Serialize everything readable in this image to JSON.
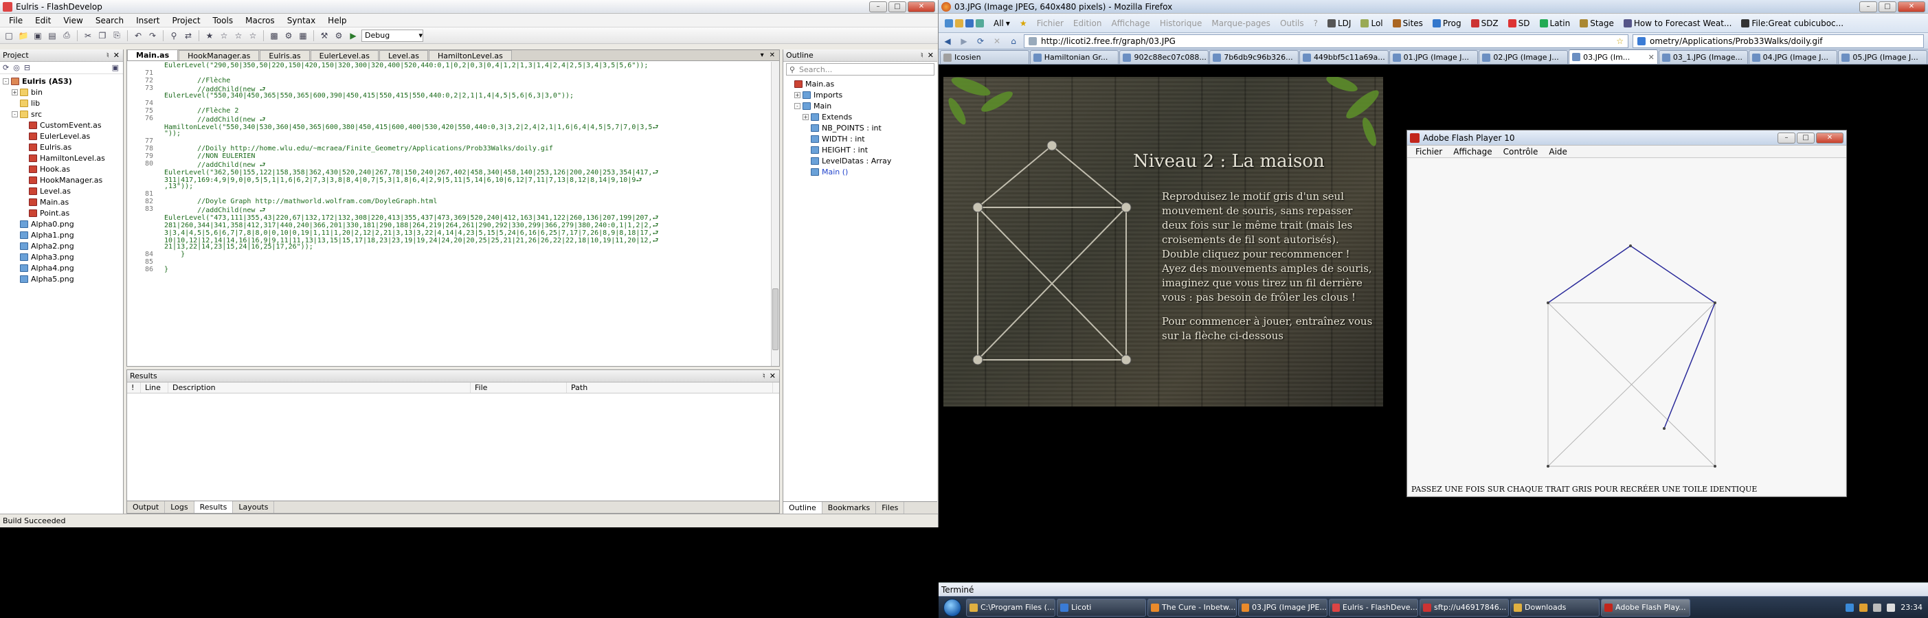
{
  "fd": {
    "title": "Eulris - FlashDevelop",
    "menu": [
      "File",
      "Edit",
      "View",
      "Search",
      "Insert",
      "Project",
      "Tools",
      "Macros",
      "Syntax",
      "Help"
    ],
    "build_config": "Debug",
    "project_panel_title": "Project",
    "tree": [
      {
        "label": "Eulris (AS3)",
        "indent": 0,
        "type": "proj",
        "exp": "-",
        "bold": true
      },
      {
        "label": "bin",
        "indent": 1,
        "type": "folder",
        "exp": "+"
      },
      {
        "label": "lib",
        "indent": 1,
        "type": "folder",
        "exp": ""
      },
      {
        "label": "src",
        "indent": 1,
        "type": "folder",
        "exp": "-"
      },
      {
        "label": "CustomEvent.as",
        "indent": 2,
        "type": "as",
        "exp": ""
      },
      {
        "label": "EulerLevel.as",
        "indent": 2,
        "type": "as",
        "exp": ""
      },
      {
        "label": "Eulris.as",
        "indent": 2,
        "type": "as",
        "exp": ""
      },
      {
        "label": "HamiltonLevel.as",
        "indent": 2,
        "type": "as",
        "exp": ""
      },
      {
        "label": "Hook.as",
        "indent": 2,
        "type": "as",
        "exp": ""
      },
      {
        "label": "HookManager.as",
        "indent": 2,
        "type": "as",
        "exp": ""
      },
      {
        "label": "Level.as",
        "indent": 2,
        "type": "as",
        "exp": ""
      },
      {
        "label": "Main.as",
        "indent": 2,
        "type": "as",
        "exp": ""
      },
      {
        "label": "Point.as",
        "indent": 2,
        "type": "as",
        "exp": ""
      },
      {
        "label": "Alpha0.png",
        "indent": 1,
        "type": "png",
        "exp": ""
      },
      {
        "label": "Alpha1.png",
        "indent": 1,
        "type": "png",
        "exp": ""
      },
      {
        "label": "Alpha2.png",
        "indent": 1,
        "type": "png",
        "exp": ""
      },
      {
        "label": "Alpha3.png",
        "indent": 1,
        "type": "png",
        "exp": ""
      },
      {
        "label": "Alpha4.png",
        "indent": 1,
        "type": "png",
        "exp": ""
      },
      {
        "label": "Alpha5.png",
        "indent": 1,
        "type": "png",
        "exp": ""
      }
    ],
    "editor_tabs": [
      "Main.as",
      "HookManager.as",
      "Eulris.as",
      "EulerLevel.as",
      "Level.as",
      "HamiltonLevel.as"
    ],
    "code": [
      {
        "n": "",
        "t": "EulerLevel(\"290,50|350,50|220,150|420,150|320,300|320,400|520,440:0,1|0,2|0,3|0,4|1,2|1,3|1,4|2,4|2,5|3,4|3,5|5,6\"));"
      },
      {
        "n": "71",
        "t": ""
      },
      {
        "n": "72",
        "t": "        //Flèche"
      },
      {
        "n": "73",
        "t": "        //addChild(new ⮐"
      },
      {
        "n": "",
        "t": "EulerLevel(\"550,340|450,365|550,365|600,390|450,415|550,415|550,440:0,2|2,1|1,4|4,5|5,6|6,3|3,0\"));"
      },
      {
        "n": "74",
        "t": ""
      },
      {
        "n": "75",
        "t": "        //Flèche 2"
      },
      {
        "n": "76",
        "t": "        //addChild(new ⮐"
      },
      {
        "n": "",
        "t": "HamiltonLevel(\"550,340|530,360|450,365|600,380|450,415|600,400|530,420|550,440:0,3|3,2|2,4|2,1|1,6|6,4|4,5|5,7|7,0|3,5⮐"
      },
      {
        "n": "",
        "t": "\"));"
      },
      {
        "n": "77",
        "t": ""
      },
      {
        "n": "78",
        "t": "        //Doily http://home.wlu.edu/~mcraea/Finite_Geometry/Applications/Prob33Walks/doily.gif"
      },
      {
        "n": "79",
        "t": "        //NON EULERIEN"
      },
      {
        "n": "80",
        "t": "        //addChild(new ⮐"
      },
      {
        "n": "",
        "t": "EulerLevel(\"362,50|155,122|158,358|362,430|520,240|267,78|150,240|267,402|458,340|458,140|253,126|200,240|253,354|417,⮐"
      },
      {
        "n": "",
        "t": "311|417,169:4,9|9,0|0,5|5,1|1,6|6,2|7,3|3,8|8,4|0,7|5,3|1,8|6,4|2,9|5,11|5,14|6,10|6,12|7,11|7,13|8,12|8,14|9,10|9⮐"
      },
      {
        "n": "",
        "t": ",13\"));"
      },
      {
        "n": "81",
        "t": ""
      },
      {
        "n": "82",
        "t": "        //Doyle Graph http://mathworld.wolfram.com/DoyleGraph.html"
      },
      {
        "n": "83",
        "t": "        //addChild(new ⮐"
      },
      {
        "n": "",
        "t": "EulerLevel(\"473,111|355,43|220,67|132,172|132,308|220,413|355,437|473,369|520,240|412,163|341,122|260,136|207,199|207,⮐"
      },
      {
        "n": "",
        "t": "281|260,344|341,358|412,317|440,240|366,201|330,181|290,188|264,219|264,261|290,292|330,299|366,279|380,240:0,1|1,2|2,⮐"
      },
      {
        "n": "",
        "t": "3|3,4|4,5|5,6|6,7|7,8|8,0|0,10|0,19|1,11|1,20|2,12|2,21|3,13|3,22|4,14|4,23|5,15|5,24|6,16|6,25|7,17|7,26|8,9|8,18|17,⮐"
      },
      {
        "n": "",
        "t": "10|10,12|12,14|14,16|16,9|9,11|11,13|13,15|15,17|18,23|23,19|19,24|24,20|20,25|25,21|21,26|26,22|22,18|10,19|11,20|12,⮐"
      },
      {
        "n": "",
        "t": "21|13,22|14,23|15,24|16,25|17,26\"));"
      },
      {
        "n": "84",
        "t": "    }"
      },
      {
        "n": "85",
        "t": ""
      },
      {
        "n": "86",
        "t": "}"
      }
    ],
    "outline_title": "Outline",
    "outline_search_placeholder": "Search...",
    "outline_tree": [
      {
        "label": "Main.as",
        "indent": 0,
        "exp": ""
      },
      {
        "label": "Imports",
        "indent": 1,
        "exp": "+"
      },
      {
        "label": "Main",
        "indent": 1,
        "exp": "-"
      },
      {
        "label": "Extends",
        "indent": 2,
        "exp": "+"
      },
      {
        "label": "NB_POINTS : int",
        "indent": 2,
        "exp": ""
      },
      {
        "label": "WIDTH : int",
        "indent": 2,
        "exp": ""
      },
      {
        "label": "HEIGHT : int",
        "indent": 2,
        "exp": ""
      },
      {
        "label": "LevelDatas : Array",
        "indent": 2,
        "exp": ""
      },
      {
        "label": "Main ()",
        "indent": 2,
        "exp": "",
        "link": true
      }
    ],
    "outline_tabs": [
      "Outline",
      "Bookmarks",
      "Files"
    ],
    "results_title": "Results",
    "results_cols": [
      "!",
      "Line",
      "Description",
      "File",
      "Path"
    ],
    "results_tabs": [
      "Output",
      "Logs",
      "Results",
      "Layouts"
    ],
    "status": "Build Succeeded"
  },
  "ff": {
    "title": "03.JPG (Image JPEG, 640x480 pixels) - Mozilla Firefox",
    "menu_dim": [
      "Fichier",
      "Edition",
      "Affichage",
      "Historique",
      "Marque-pages",
      "Outils",
      "?"
    ],
    "all_label": "All",
    "bookmarks": [
      "LDJ",
      "Lol",
      "Sites",
      "Prog",
      "SDZ",
      "SD",
      "Latin",
      "Stage",
      "How to Forecast Weat...",
      "File:Great cubicuboc..."
    ],
    "url": "http://licoti2.free.fr/graph/03.JPG",
    "search_value": "ometry/Applications/Prob33Walks/doily.gif",
    "tabs": [
      "Icosien",
      "Hamiltonian Gr...",
      "902c88ec07c088...",
      "7b6db9c96b326...",
      "449bbf5c11a69a...",
      "01.JPG (Image J...",
      "02.JPG (Image J...",
      "03.JPG (Im...",
      "03_1.JPG (Image...",
      "04.JPG (Image J...",
      "05.JPG (Image J..."
    ],
    "active_tab": 7,
    "status": "Terminé"
  },
  "game": {
    "title": "Niveau 2 : La maison",
    "para1": "Reproduisez le motif gris d'un seul mouvement de souris, sans repasser deux fois sur le même trait (mais les croisements de fil sont autorisés). Double cliquez pour recommencer ! Ayez des mouvements amples de souris, imaginez que vous tirez un fil derrière vous : pas besoin de frôler les clous !",
    "para2": "Pour commencer à jouer, entraînez vous sur la flèche ci-dessous"
  },
  "flash": {
    "title": "Adobe Flash Player 10",
    "menu": [
      "Fichier",
      "Affichage",
      "Contrôle",
      "Aide"
    ],
    "caption": "PASSEZ UNE FOIS SUR CHAQUE TRAIT GRIS POUR RECRÉER UNE TOILE IDENTIQUE"
  },
  "taskbar": {
    "tasks": [
      "C:\\Program Files (...",
      "Licoti",
      "The Cure - Inbetw...",
      "03.JPG (Image JPE...",
      "Eulris - FlashDeve...",
      "sftp://u46917846...",
      "Downloads",
      "Adobe Flash Play..."
    ],
    "active": 7,
    "clock": "23:34"
  },
  "colors": {
    "code_green": "#1a6a1a",
    "flash_line": "#2a2a9a",
    "flash_guide": "#aaaaaa"
  }
}
